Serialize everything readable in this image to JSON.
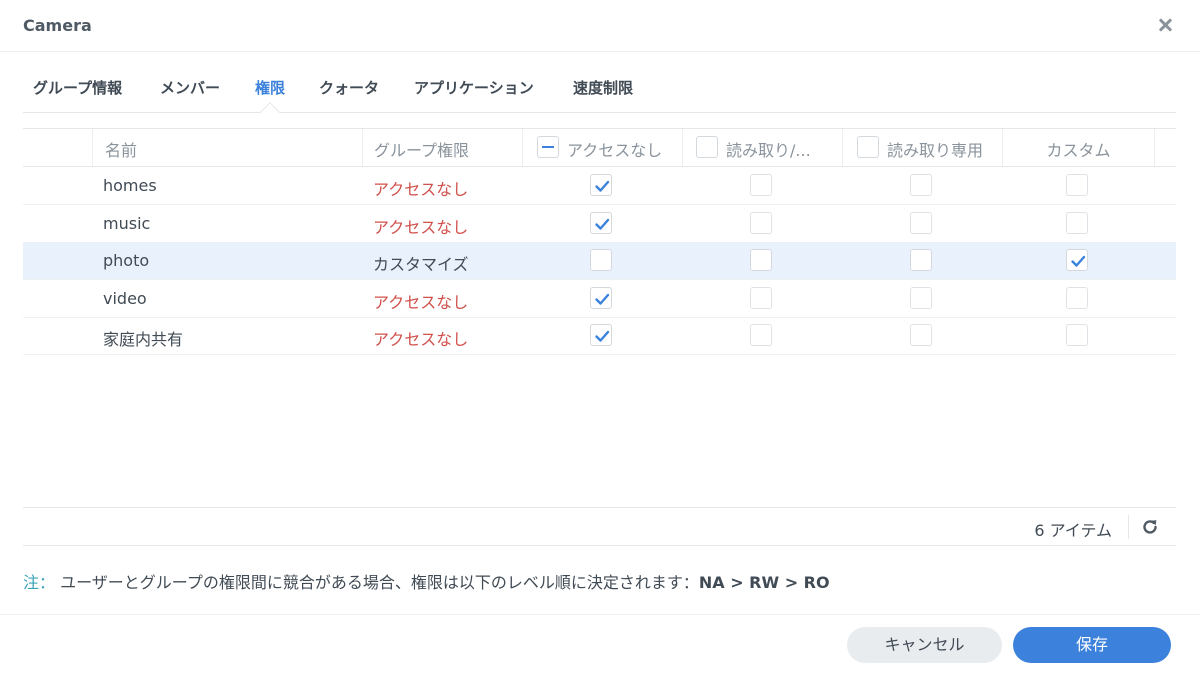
{
  "window": {
    "title": "Camera"
  },
  "tabs": [
    {
      "label": "グループ情報",
      "active": false
    },
    {
      "label": "メンバー",
      "active": false
    },
    {
      "label": "権限",
      "active": true
    },
    {
      "label": "クォータ",
      "active": false
    },
    {
      "label": "アプリケーション",
      "active": false
    },
    {
      "label": "速度制限",
      "active": false
    }
  ],
  "grid": {
    "headers": {
      "name": "名前",
      "group_perm": "グループ権限",
      "no_access": "アクセスなし",
      "read_write": "読み取り/...",
      "read_only": "読み取り専用",
      "custom": "カスタム"
    },
    "header_checkbox_state": {
      "no_access": "indeterminate",
      "read_write": "unchecked",
      "read_only": "unchecked"
    },
    "rows": [
      {
        "name": "homes",
        "group_perm": "アクセスなし",
        "perm_type": "none",
        "no_access": true,
        "read_write": false,
        "read_only": false,
        "custom": false,
        "selected": false
      },
      {
        "name": "music",
        "group_perm": "アクセスなし",
        "perm_type": "none",
        "no_access": true,
        "read_write": false,
        "read_only": false,
        "custom": false,
        "selected": false
      },
      {
        "name": "photo",
        "group_perm": "カスタマイズ",
        "perm_type": "custom",
        "no_access": false,
        "read_write": false,
        "read_only": false,
        "custom": true,
        "selected": true
      },
      {
        "name": "video",
        "group_perm": "アクセスなし",
        "perm_type": "none",
        "no_access": true,
        "read_write": false,
        "read_only": false,
        "custom": false,
        "selected": false
      },
      {
        "name": "家庭内共有",
        "group_perm": "アクセスなし",
        "perm_type": "none",
        "no_access": true,
        "read_write": false,
        "read_only": false,
        "custom": false,
        "selected": false
      }
    ]
  },
  "footer": {
    "count": "6 アイテム"
  },
  "note": {
    "label": "注：",
    "text": "ユーザーとグループの権限間に競合がある場合、権限は以下のレベル順に決定されます：",
    "levels": "NA > RW > RO"
  },
  "buttons": {
    "cancel": "キャンセル",
    "save": "保存"
  },
  "colors": {
    "accent": "#3c82dc",
    "no_access_text": "#d0504b",
    "selected_row": "#e8f1fc",
    "note_label": "#3aa3b8"
  }
}
